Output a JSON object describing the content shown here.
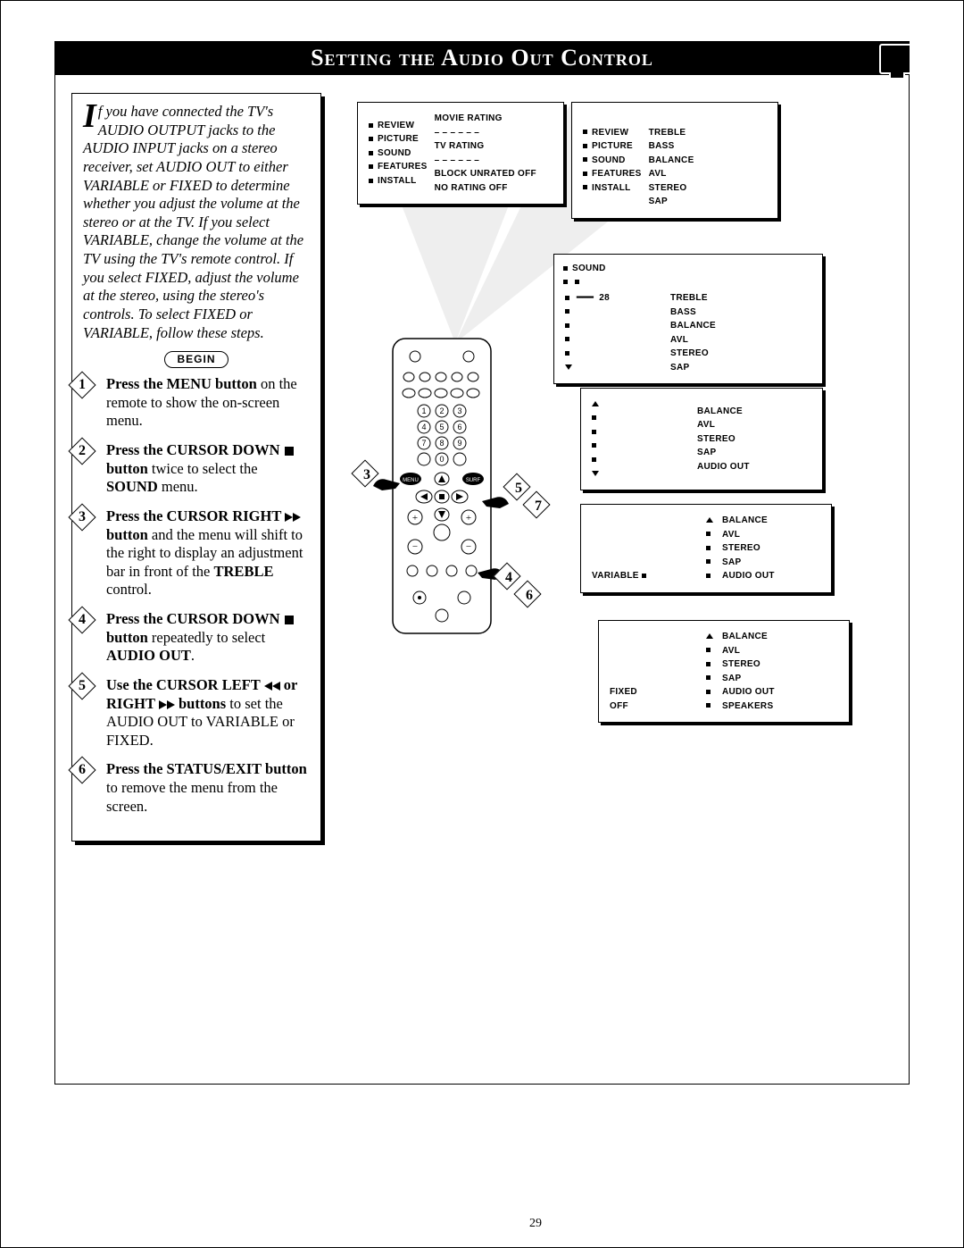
{
  "page_number": "29",
  "header": "Setting the Audio Out Control",
  "intro": "f you have connected the TV's AUDIO OUTPUT jacks to the AUDIO INPUT jacks on a stereo receiver, set AUDIO OUT to either VARIABLE or FIXED to determine whether you adjust the volume at the stereo or at the TV. If you select VARIABLE, change the volume at the TV using the TV's remote control. If you select FIXED, adjust the volume at the stereo, using the stereo's controls. To select FIXED or VARIABLE, follow these steps.",
  "dropcap": "I",
  "begin_label": "BEGIN",
  "steps": {
    "1": {
      "b1": "Press the MENU button",
      "t1": " on the remote to show the on-screen menu."
    },
    "2": {
      "b1": "Press the CURSOR DOWN ",
      "b2": " button",
      "t1": " twice to select the ",
      "b3": "SOUND",
      "t2": " menu."
    },
    "3": {
      "b1": "Press the CURSOR RIGHT ",
      "b2": " button",
      "t1": " and the menu will shift to the right to display an adjustment bar in front of the ",
      "b3": "TREBLE",
      "t2": " control."
    },
    "4": {
      "b1": "Press the CURSOR DOWN ",
      "b2": " button",
      "t1": " repeatedly to select ",
      "b3": "AUDIO OUT",
      "t2": "."
    },
    "5": {
      "b1": "Use the CURSOR LEFT ",
      "b2": " or RIGHT ",
      "b3": " buttons",
      "t1": " to set the AUDIO OUT to VARIABLE or FIXED."
    },
    "6": {
      "b1": "Press the STATUS/EXIT button",
      "t1": " to remove the menu from the screen."
    }
  },
  "menu_main_left": {
    "col1": [
      "REVIEW",
      "PICTURE",
      "SOUND",
      "FEATURES",
      "INSTALL"
    ],
    "col2": [
      "MOVIE RATING",
      "– – – – – –",
      "TV RATING",
      "– – – – – –",
      "BLOCK UNRATED  OFF",
      "NO RATING         OFF"
    ]
  },
  "menu_main_right": {
    "col1": [
      "REVIEW",
      "PICTURE",
      "SOUND",
      "FEATURES",
      "INSTALL"
    ],
    "col2": [
      "",
      "TREBLE",
      "BASS",
      "BALANCE",
      "AVL",
      "STEREO",
      "SAP"
    ]
  },
  "menu_sound": {
    "title": "SOUND",
    "val": "28",
    "items": [
      "TREBLE",
      "BASS",
      "BALANCE",
      "AVL",
      "STEREO",
      "SAP"
    ]
  },
  "menu_3": {
    "items": [
      "BALANCE",
      "AVL",
      "STEREO",
      "SAP",
      "AUDIO OUT"
    ]
  },
  "menu_4": {
    "left": "VARIABLE",
    "items": [
      "BALANCE",
      "AVL",
      "STEREO",
      "SAP",
      "AUDIO OUT"
    ]
  },
  "menu_5": {
    "left": [
      "FIXED",
      "OFF"
    ],
    "items": [
      "BALANCE",
      "AVL",
      "STEREO",
      "SAP",
      "AUDIO OUT",
      "SPEAKERS"
    ]
  }
}
